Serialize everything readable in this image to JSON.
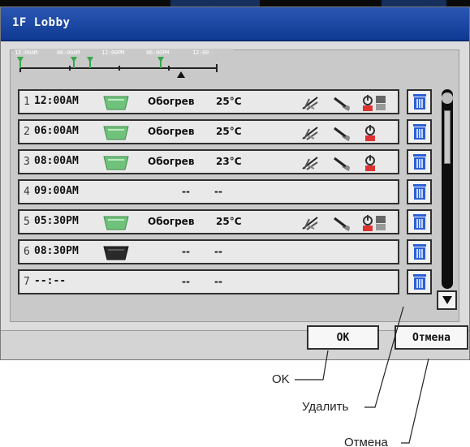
{
  "window": {
    "title": "1F Lobby"
  },
  "timeline": {
    "labels": [
      "12:00AM",
      "06:00AM",
      "12:00PM",
      "06:00PM",
      "12:00"
    ],
    "markers": [
      "start",
      "06:00AM",
      "08:00AM",
      "05:30PM"
    ]
  },
  "rows": [
    {
      "num": "1",
      "time": "12:00AM",
      "unit": "green",
      "mode": "Обогрев",
      "temp": "25°C",
      "fan": "fan-icon",
      "vane": "vane-icon",
      "power": "power-timer-icon"
    },
    {
      "num": "2",
      "time": "06:00AM",
      "unit": "green",
      "mode": "Обогрев",
      "temp": "25°C",
      "fan": "fan-icon",
      "vane": "vane-icon",
      "power": "power-icon"
    },
    {
      "num": "3",
      "time": "08:00AM",
      "unit": "green",
      "mode": "Обогрев",
      "temp": "23°C",
      "fan": "fan-icon",
      "vane": "vane-icon",
      "power": "power-icon"
    },
    {
      "num": "4",
      "time": "09:00AM",
      "unit": "none",
      "dash1": "--",
      "dash2": "--"
    },
    {
      "num": "5",
      "time": "05:30PM",
      "unit": "green",
      "mode": "Обогрев",
      "temp": "25°C",
      "fan": "fan-icon",
      "vane": "vane-icon",
      "power": "power-timer-icon"
    },
    {
      "num": "6",
      "time": "08:30PM",
      "unit": "dark",
      "dash1": "--",
      "dash2": "--"
    },
    {
      "num": "7",
      "time": "--:--",
      "unit": "none",
      "dash1": "--",
      "dash2": "--"
    }
  ],
  "buttons": {
    "ok": "OK",
    "cancel": "Отмена"
  },
  "callouts": {
    "ok": "OK",
    "delete": "Удалить",
    "cancel": "Отмена"
  },
  "colors": {
    "title_bar": "#1f4aa8",
    "unit_green": "#6fc27a",
    "trash_blue": "#2b5fd6",
    "timeline_marker": "#34a84a"
  }
}
